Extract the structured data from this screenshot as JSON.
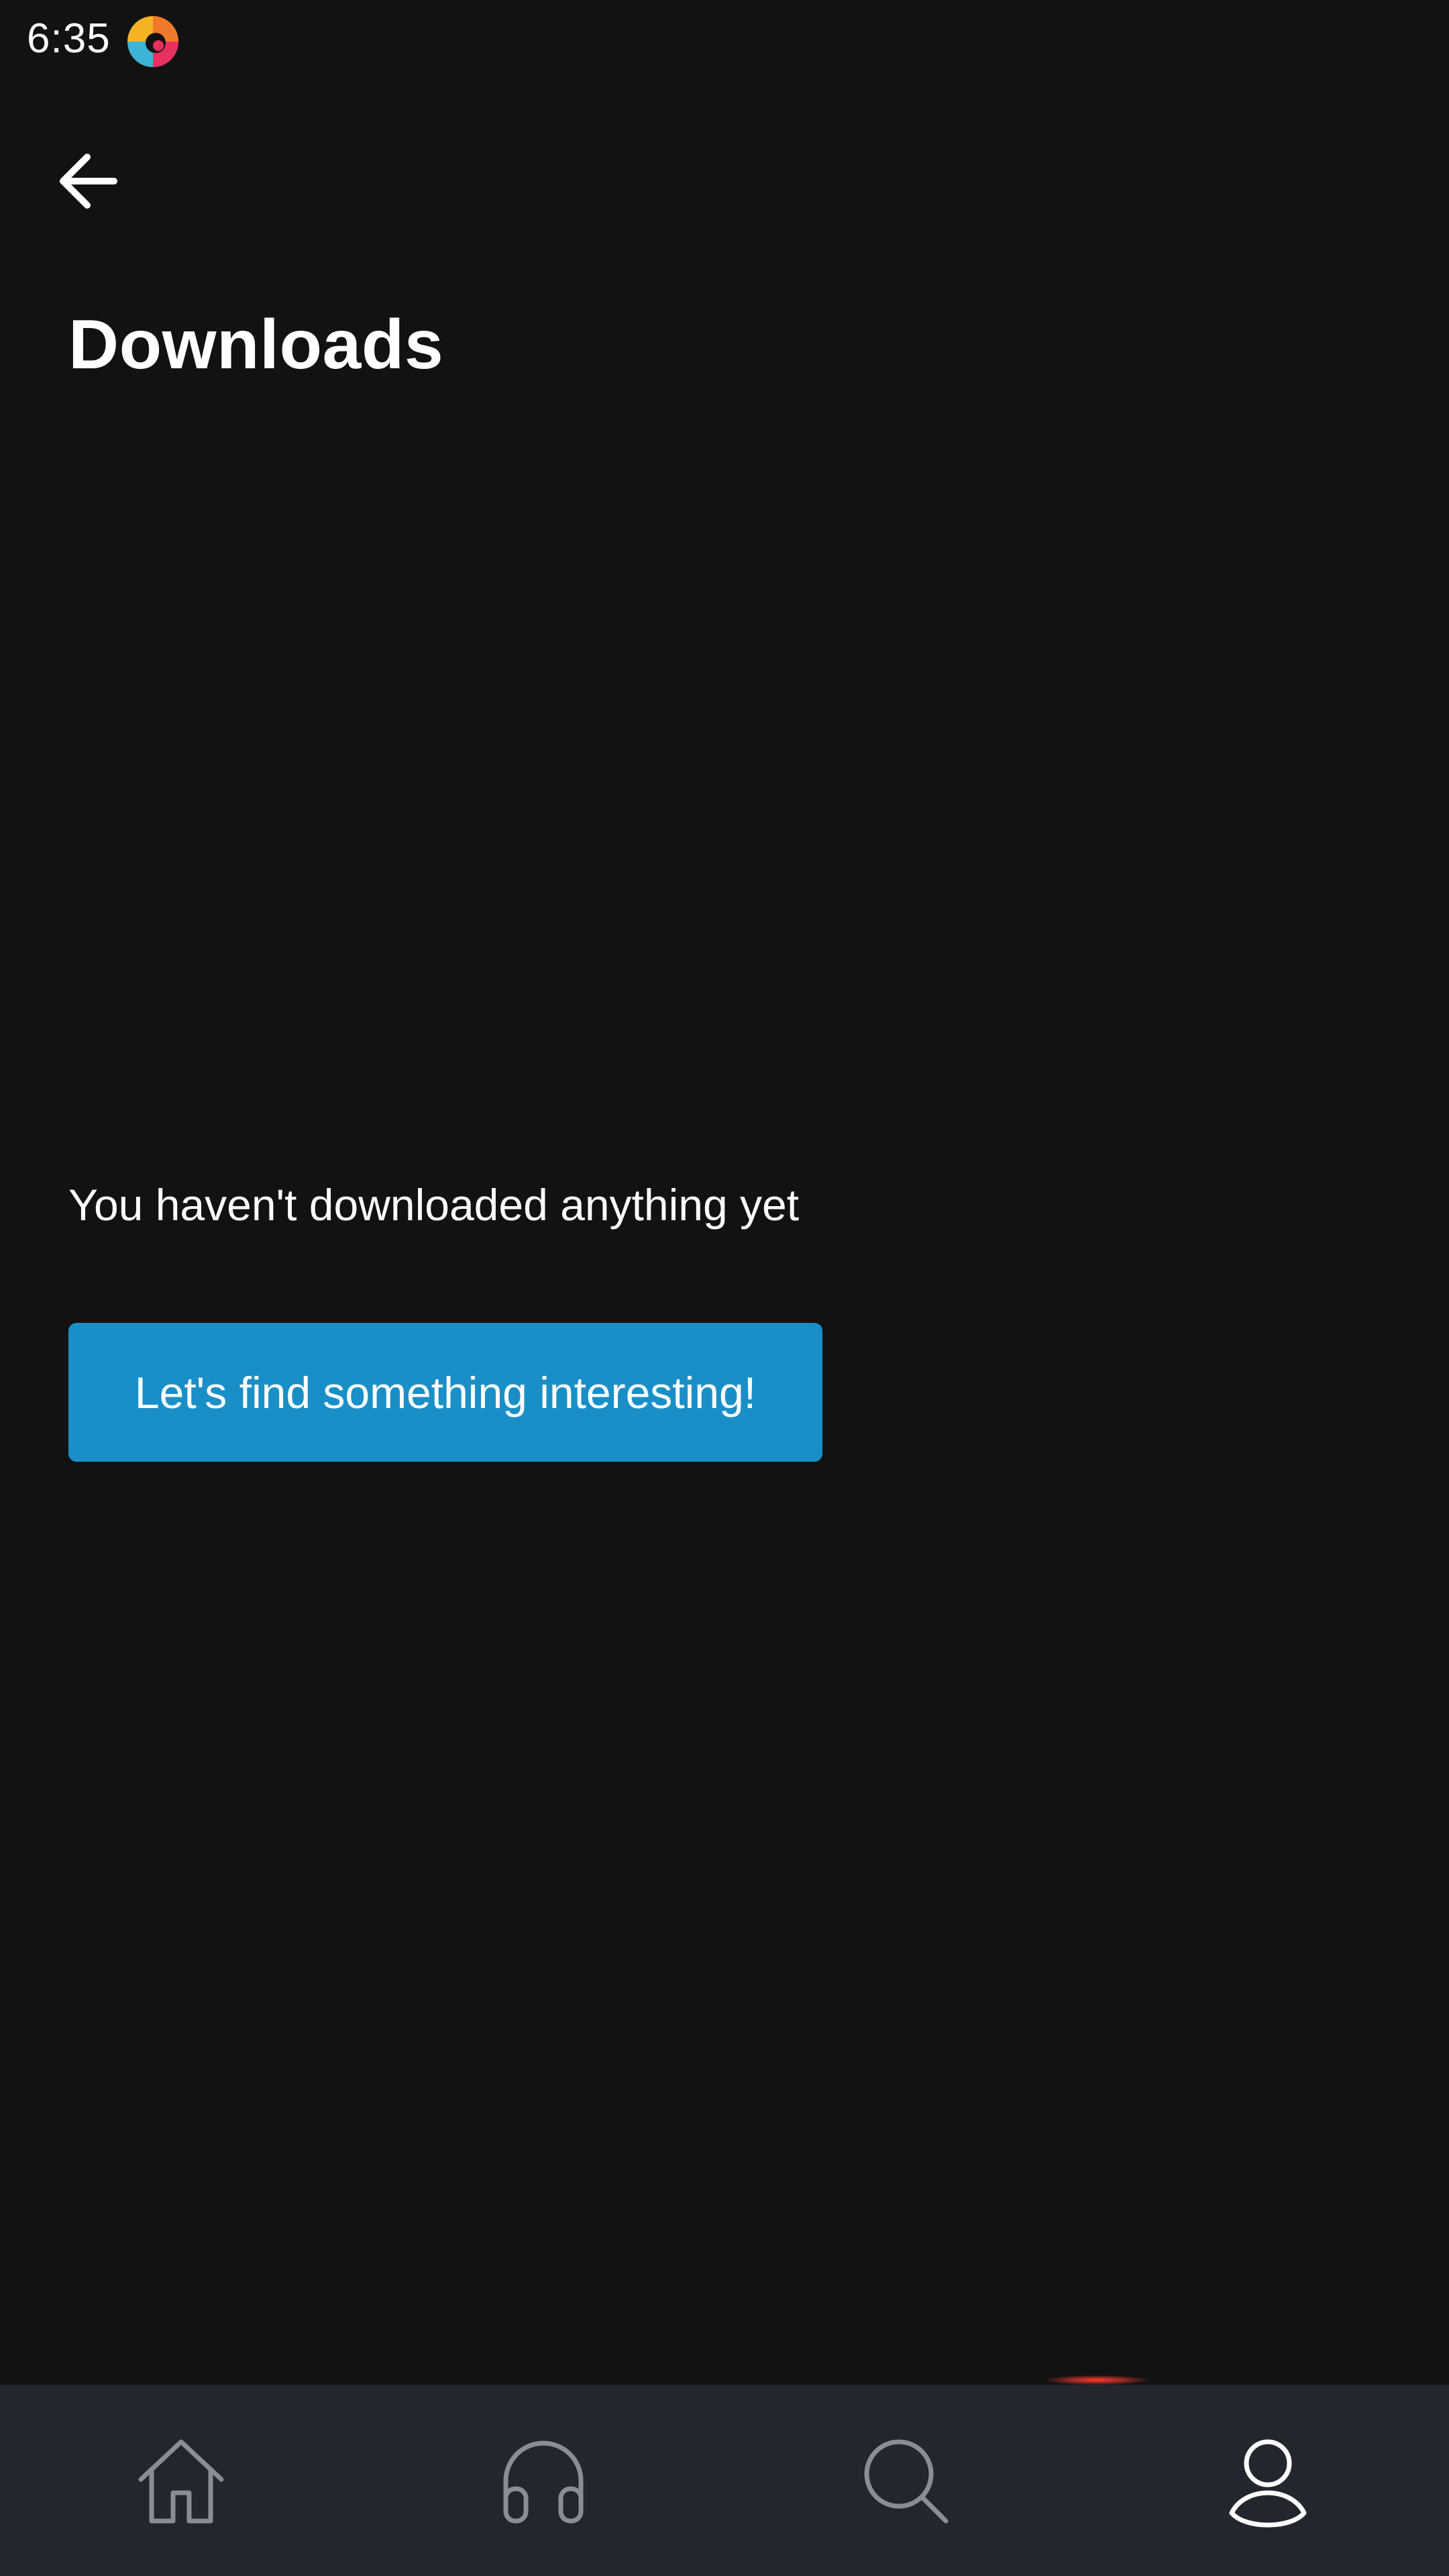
{
  "status_bar": {
    "time": "6:35",
    "app_icon": "colorful-swirl-app-icon"
  },
  "header": {
    "back_icon": "arrow-left-icon",
    "title": "Downloads"
  },
  "empty_state": {
    "message": "You haven't downloaded anything yet",
    "cta_label": "Let's find something interesting!"
  },
  "bottom_nav": {
    "items": [
      {
        "icon": "home-icon",
        "active": false
      },
      {
        "icon": "headphones-icon",
        "active": false
      },
      {
        "icon": "search-icon",
        "active": false
      },
      {
        "icon": "profile-icon",
        "active": true
      }
    ]
  },
  "colors": {
    "background": "#121213",
    "nav_background": "#23262c",
    "cta_background": "#1a8fc7",
    "active_icon": "#ffffff",
    "inactive_icon": "#8a8d92",
    "accent_indicator": "#ff3b2f"
  }
}
